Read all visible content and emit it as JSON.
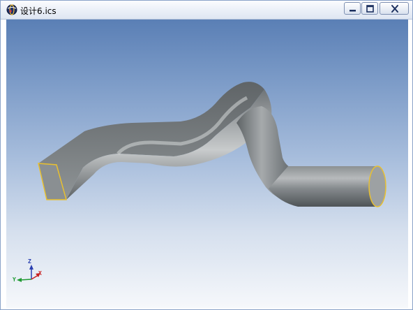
{
  "window": {
    "title": "设计6.ics",
    "app_icon": "globe-app-icon",
    "controls": {
      "minimize": "minimize-icon",
      "maximize": "maximize-icon",
      "close": "close-icon"
    }
  },
  "viewport": {
    "background_top": "#5a7fb5",
    "background_bottom": "#f6f8fb",
    "model": {
      "shape": "swept-pipe-square-to-round",
      "surface_color": "#8f9396",
      "edge_highlight": "#e8c030"
    },
    "axes": {
      "z": "Z",
      "y": "Y",
      "x": "X"
    }
  }
}
